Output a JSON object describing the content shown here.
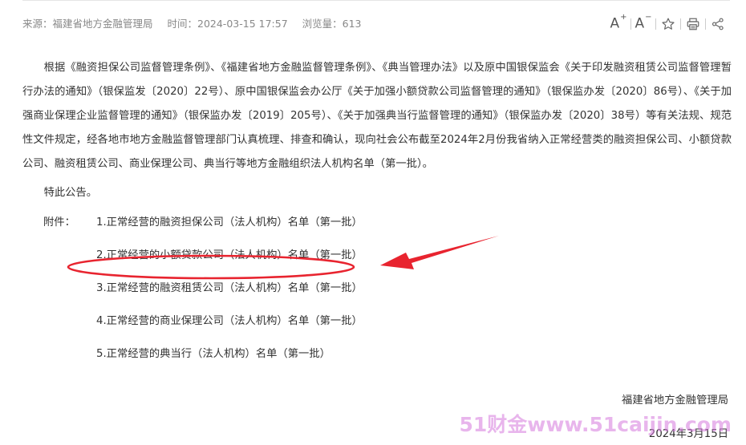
{
  "meta": {
    "source": "来源：福建省地方金融管理局",
    "time": "时间：2024-03-15 17:57",
    "views": "浏览量：613"
  },
  "toolbar": {
    "font_increase": "A",
    "font_increase_mark": "+",
    "font_decrease": "A",
    "font_decrease_mark": "−"
  },
  "article": {
    "paragraph": "根据《融资担保公司监督管理条例》、《福建省地方金融监督管理条例》、《典当管理办法》以及原中国银保监会《关于印发融资租赁公司监督管理暂行办法的通知》（银保监发〔2020〕22号）、原中国银保监会办公厅《关于加强小额贷款公司监督管理的通知》（银保监办发〔2020〕86号）、《关于加强商业保理企业监督管理的通知》（银保监办发〔2019〕205号）、《关于加强典当行监督管理的通知》（银保监办发〔2020〕38号）等有关法规、规范性文件规定，经各地市地方金融监督管理部门认真梳理、排查和确认，现向社会公布截至2024年2月份我省纳入正常经营类的融资担保公司、小额贷款公司、融资租赁公司、商业保理公司、典当行等地方金融组织法人机构名单（第一批）。",
    "notice": "特此公告。",
    "attachment_label": "附件：",
    "attachments": [
      "1.正常经营的融资担保公司（法人机构）名单（第一批）",
      "2.正常经营的小额贷款公司（法人机构）名单（第一批）",
      "3.正常经营的融资租赁公司（法人机构）名单（第一批）",
      "4.正常经营的商业保理公司（法人机构）名单（第一批）",
      "5.正常经营的典当行（法人机构）名单（第一批）"
    ],
    "signature_org": "福建省地方金融管理局",
    "signature_date": "2024年3月15日"
  },
  "annotation": {
    "color": "#e8242f"
  },
  "watermark": {
    "text": "51财金www.51caijin.com"
  }
}
